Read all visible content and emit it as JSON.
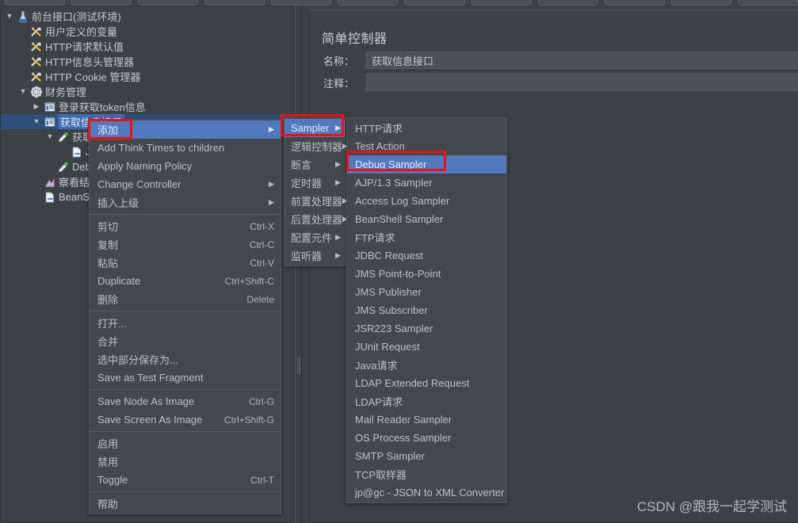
{
  "colors": {
    "window_bg": "#3c4146",
    "menu_bg": "#43484d",
    "highlight_blue": "#5079c0",
    "tree_select": "#3c6cb4",
    "annotation_red": "#ee1111",
    "text": "#b9c0c8"
  },
  "toolbar": {
    "buttons": [
      "new",
      "templates",
      "open",
      "save",
      "cut",
      "copy",
      "paste",
      "expand",
      "collapse",
      "toggle",
      "start",
      "stop"
    ]
  },
  "tree": {
    "nodes": [
      {
        "label": "前台接口(测试环境)",
        "icon": "test-plan-icon",
        "depth": 0,
        "twisty": "expanded",
        "selected": false
      },
      {
        "label": "用户定义的变量",
        "icon": "config-element-icon",
        "depth": 1,
        "twisty": "none",
        "selected": false
      },
      {
        "label": "HTTP请求默认值",
        "icon": "config-element-icon",
        "depth": 1,
        "twisty": "none",
        "selected": false
      },
      {
        "label": "HTTP信息头管理器",
        "icon": "config-element-icon",
        "depth": 1,
        "twisty": "none",
        "selected": false
      },
      {
        "label": "HTTP Cookie 管理器",
        "icon": "config-element-icon",
        "depth": 1,
        "twisty": "none",
        "selected": false
      },
      {
        "label": "财务管理",
        "icon": "thread-group-icon",
        "depth": 1,
        "twisty": "expanded",
        "selected": false
      },
      {
        "label": "登录获取token信息",
        "icon": "controller-icon",
        "depth": 2,
        "twisty": "collapsed",
        "selected": false
      },
      {
        "label": "获取信息接口",
        "icon": "controller-icon",
        "depth": 2,
        "twisty": "expanded",
        "selected": true
      },
      {
        "label": "获取信息",
        "icon": "sampler-icon",
        "depth": 3,
        "twisty": "expanded",
        "selected": false
      },
      {
        "label": "JSON",
        "icon": "post-processor-icon",
        "depth": 4,
        "twisty": "none",
        "selected": false
      },
      {
        "label": "Debug Sa",
        "icon": "sampler-icon",
        "depth": 3,
        "twisty": "none",
        "selected": false
      },
      {
        "label": "察看结果树",
        "icon": "listener-icon",
        "depth": 2,
        "twisty": "none",
        "selected": false
      },
      {
        "label": "BeanShell",
        "icon": "post-processor-icon",
        "depth": 2,
        "twisty": "none",
        "selected": false
      }
    ]
  },
  "right_panel": {
    "title": "简单控制器",
    "name_label": "名称：",
    "name_value": "获取信息接口",
    "comment_label": "注释：",
    "comment_value": ""
  },
  "context_menu": {
    "items": [
      {
        "label": "添加",
        "accel": "",
        "submenu": true,
        "highlighted": true,
        "separator_after": false
      },
      {
        "label": "Add Think Times to children",
        "accel": "",
        "submenu": false,
        "highlighted": false,
        "separator_after": false
      },
      {
        "label": "Apply Naming Policy",
        "accel": "",
        "submenu": false,
        "highlighted": false,
        "separator_after": false
      },
      {
        "label": "Change Controller",
        "accel": "",
        "submenu": true,
        "highlighted": false,
        "separator_after": false
      },
      {
        "label": "插入上级",
        "accel": "",
        "submenu": true,
        "highlighted": false,
        "separator_after": true
      },
      {
        "label": "剪切",
        "accel": "Ctrl-X",
        "submenu": false,
        "highlighted": false,
        "separator_after": false
      },
      {
        "label": "复制",
        "accel": "Ctrl-C",
        "submenu": false,
        "highlighted": false,
        "separator_after": false
      },
      {
        "label": "粘贴",
        "accel": "Ctrl-V",
        "submenu": false,
        "highlighted": false,
        "separator_after": false
      },
      {
        "label": "Duplicate",
        "accel": "Ctrl+Shift-C",
        "submenu": false,
        "highlighted": false,
        "separator_after": false
      },
      {
        "label": "删除",
        "accel": "Delete",
        "submenu": false,
        "highlighted": false,
        "separator_after": true
      },
      {
        "label": "打开...",
        "accel": "",
        "submenu": false,
        "highlighted": false,
        "separator_after": false
      },
      {
        "label": "合并",
        "accel": "",
        "submenu": false,
        "highlighted": false,
        "separator_after": false
      },
      {
        "label": "选中部分保存为...",
        "accel": "",
        "submenu": false,
        "highlighted": false,
        "separator_after": false
      },
      {
        "label": "Save as Test Fragment",
        "accel": "",
        "submenu": false,
        "highlighted": false,
        "separator_after": true
      },
      {
        "label": "Save Node As Image",
        "accel": "Ctrl-G",
        "submenu": false,
        "highlighted": false,
        "separator_after": false
      },
      {
        "label": "Save Screen As Image",
        "accel": "Ctrl+Shift-G",
        "submenu": false,
        "highlighted": false,
        "separator_after": true
      },
      {
        "label": "启用",
        "accel": "",
        "submenu": false,
        "highlighted": false,
        "separator_after": false
      },
      {
        "label": "禁用",
        "accel": "",
        "submenu": false,
        "highlighted": false,
        "separator_after": false
      },
      {
        "label": "Toggle",
        "accel": "Ctrl-T",
        "submenu": false,
        "highlighted": false,
        "separator_after": true
      },
      {
        "label": "帮助",
        "accel": "",
        "submenu": false,
        "highlighted": false,
        "separator_after": false
      }
    ]
  },
  "add_submenu": {
    "items": [
      {
        "label": "Sampler",
        "submenu": true,
        "highlighted": true
      },
      {
        "label": "逻辑控制器",
        "submenu": true,
        "highlighted": false
      },
      {
        "label": "断言",
        "submenu": true,
        "highlighted": false
      },
      {
        "label": "定时器",
        "submenu": true,
        "highlighted": false
      },
      {
        "label": "前置处理器",
        "submenu": true,
        "highlighted": false
      },
      {
        "label": "后置处理器",
        "submenu": true,
        "highlighted": false
      },
      {
        "label": "配置元件",
        "submenu": true,
        "highlighted": false
      },
      {
        "label": "监听器",
        "submenu": true,
        "highlighted": false
      }
    ]
  },
  "sampler_submenu": {
    "items": [
      {
        "label": "HTTP请求",
        "highlighted": false
      },
      {
        "label": "Test Action",
        "highlighted": false
      },
      {
        "label": "Debug Sampler",
        "highlighted": true
      },
      {
        "label": "AJP/1.3 Sampler",
        "highlighted": false
      },
      {
        "label": "Access Log Sampler",
        "highlighted": false
      },
      {
        "label": "BeanShell Sampler",
        "highlighted": false
      },
      {
        "label": "FTP请求",
        "highlighted": false
      },
      {
        "label": "JDBC Request",
        "highlighted": false
      },
      {
        "label": "JMS Point-to-Point",
        "highlighted": false
      },
      {
        "label": "JMS Publisher",
        "highlighted": false
      },
      {
        "label": "JMS Subscriber",
        "highlighted": false
      },
      {
        "label": "JSR223 Sampler",
        "highlighted": false
      },
      {
        "label": "JUnit Request",
        "highlighted": false
      },
      {
        "label": "Java请求",
        "highlighted": false
      },
      {
        "label": "LDAP Extended Request",
        "highlighted": false
      },
      {
        "label": "LDAP请求",
        "highlighted": false
      },
      {
        "label": "Mail Reader Sampler",
        "highlighted": false
      },
      {
        "label": "OS Process Sampler",
        "highlighted": false
      },
      {
        "label": "SMTP Sampler",
        "highlighted": false
      },
      {
        "label": "TCP取样器",
        "highlighted": false
      },
      {
        "label": "jp@gc - JSON to XML Converter",
        "highlighted": false
      }
    ]
  },
  "annotations": {
    "boxes": [
      "add-menu-item",
      "sampler-menu-item",
      "debug-sampler-menu-item"
    ]
  },
  "watermark": {
    "text": "CSDN @跟我一起学测试"
  }
}
